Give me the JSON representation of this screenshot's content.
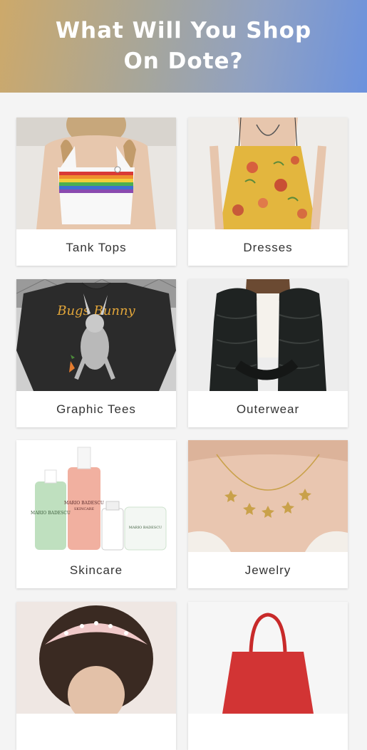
{
  "header": {
    "title": "What Will You Shop On Dote?"
  },
  "categories": [
    {
      "label": "Tank Tops",
      "icon": "tank-top-photo"
    },
    {
      "label": "Dresses",
      "icon": "dress-photo"
    },
    {
      "label": "Graphic Tees",
      "icon": "graphic-tee-photo"
    },
    {
      "label": "Outerwear",
      "icon": "puffer-jacket-photo"
    },
    {
      "label": "Skincare",
      "icon": "skincare-products-photo"
    },
    {
      "label": "Jewelry",
      "icon": "necklace-photo"
    },
    {
      "label": "",
      "icon": "headband-photo"
    },
    {
      "label": "",
      "icon": "handbag-photo"
    }
  ],
  "product_text": {
    "tee_print": "Bugs Bunny",
    "skincare_brand": "MARIO BADESCU",
    "skincare_sub": "SKINCARE"
  },
  "colors": {
    "header_gradient_start": "#cda96a",
    "header_gradient_end": "#6c92dd",
    "background": "#f4f4f4",
    "card": "#ffffff",
    "label_text": "#333333"
  }
}
